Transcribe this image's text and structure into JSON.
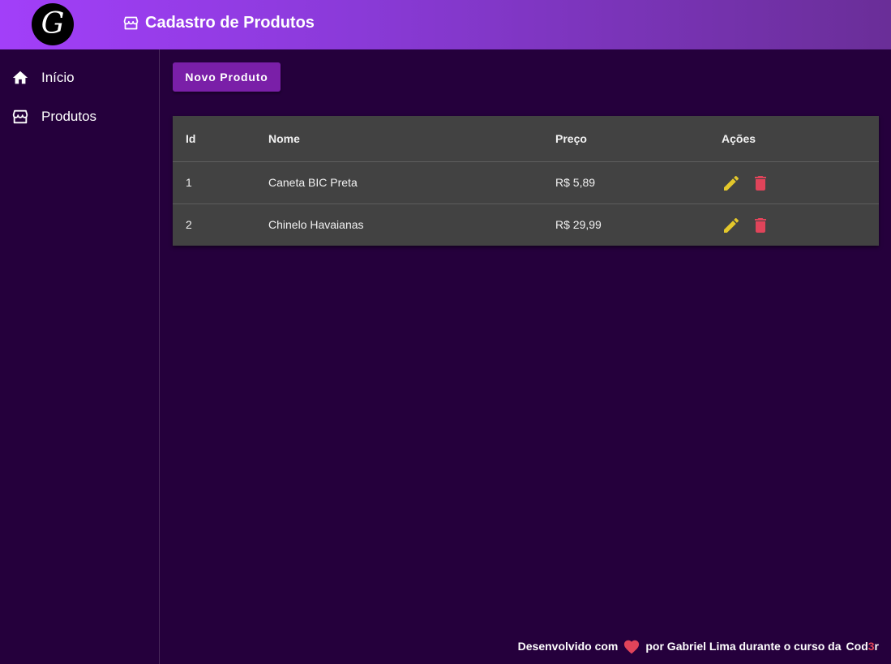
{
  "header": {
    "logo_letter": "G",
    "title": "Cadastro de Produtos",
    "title_icon": "store-icon"
  },
  "sidebar": {
    "items": [
      {
        "label": "Início",
        "icon": "home-icon"
      },
      {
        "label": "Produtos",
        "icon": "store-icon"
      }
    ]
  },
  "main": {
    "new_button_label": "Novo Produto",
    "table": {
      "columns": [
        "Id",
        "Nome",
        "Preço",
        "Ações"
      ],
      "rows": [
        {
          "id": "1",
          "nome": "Caneta BIC Preta",
          "preco": "R$ 5,89"
        },
        {
          "id": "2",
          "nome": "Chinelo Havaianas",
          "preco": "R$ 29,99"
        }
      ]
    }
  },
  "footer": {
    "prefix": "Desenvolvido com",
    "suffix": "por Gabriel Lima durante o curso da",
    "brand_part1": "Cod",
    "brand_part2": "3",
    "brand_part3": "r"
  },
  "colors": {
    "background": "#25003c",
    "accent": "#7a1fa8",
    "edit": "#e3c72b",
    "delete": "#e0445a"
  }
}
